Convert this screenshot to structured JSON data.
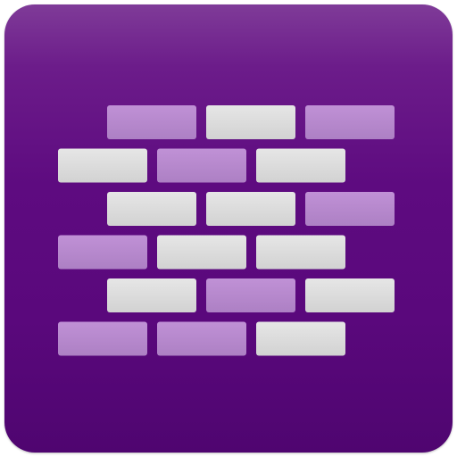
{
  "icon": {
    "name": "brick-wall-icon",
    "colors": {
      "background_top": "#7f3b98",
      "background_bottom": "#4f0570",
      "brick_light": "#dedede",
      "brick_purple": "#b98ccf"
    },
    "rows": [
      [
        "purple",
        "light",
        "purple"
      ],
      [
        "light",
        "purple",
        "light"
      ],
      [
        "light",
        "light",
        "purple"
      ],
      [
        "purple",
        "light",
        "light"
      ],
      [
        "light",
        "purple",
        "light"
      ],
      [
        "purple",
        "purple",
        "light"
      ]
    ]
  }
}
